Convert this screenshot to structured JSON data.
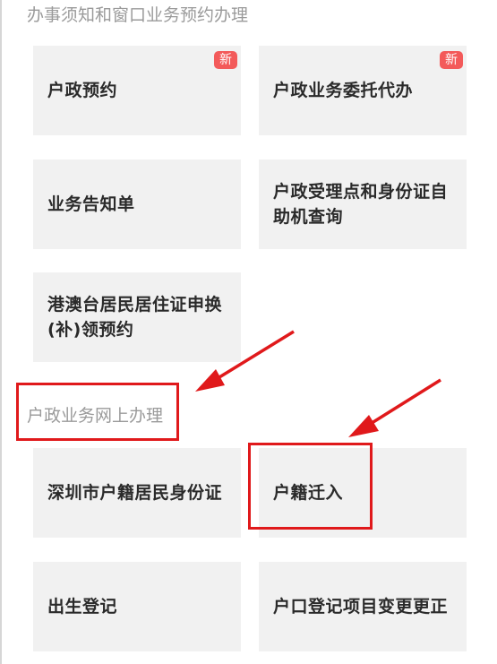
{
  "section1": {
    "title": "办事须知和窗口业务预约办理",
    "tiles": [
      {
        "label": "户政预约",
        "badge": "新"
      },
      {
        "label": "户政业务委托代办",
        "badge": "新"
      },
      {
        "label": "业务告知单"
      },
      {
        "label": "户政受理点和身份证自助机查询"
      },
      {
        "label": "港澳台居民居住证申换(补)领预约"
      }
    ]
  },
  "section2": {
    "title": "户政业务网上办理",
    "tiles": [
      {
        "label": "深圳市户籍居民身份证"
      },
      {
        "label": "户籍迁入"
      },
      {
        "label": "出生登记"
      },
      {
        "label": "户口登记项目变更更正"
      }
    ]
  },
  "annotations": {
    "highlight_color": "#e0191b",
    "badge_color": "#f35a5a"
  }
}
